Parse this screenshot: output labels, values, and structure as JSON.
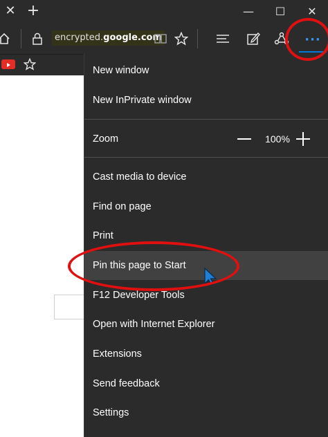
{
  "window": {
    "tab_close_glyph": "✕",
    "new_tab_glyph": "+",
    "minimize_glyph": "—",
    "maximize_glyph": "☐",
    "close_glyph": "✕"
  },
  "address": {
    "prefix": "encrypted.",
    "domain": "google.com"
  },
  "icons": {
    "home": "home-icon",
    "lock": "lock-icon",
    "reading_view": "reading-view-icon",
    "favorite": "star-icon",
    "hub": "hub-icon",
    "web_note": "web-note-icon",
    "share": "share-icon",
    "more": "more-icon",
    "youtube": "youtube-icon",
    "add_favorite": "star-outline-icon"
  },
  "colors": {
    "chrome_bg": "#2b2b2b",
    "menu_bg": "#2b2b2b",
    "highlight_bg": "#414141",
    "accent_blue": "#0078d7",
    "annotation_red": "#e01010"
  },
  "more_button_label": "···",
  "menu": {
    "new_window": "New window",
    "new_inprivate": "New InPrivate window",
    "zoom_label": "Zoom",
    "zoom_value": "100%",
    "zoom_minus": "—",
    "zoom_plus": "+",
    "cast": "Cast media to device",
    "find": "Find on page",
    "print": "Print",
    "pin": "Pin this page to Start",
    "devtools": "F12 Developer Tools",
    "open_ie": "Open with Internet Explorer",
    "extensions": "Extensions",
    "feedback": "Send feedback",
    "settings": "Settings"
  }
}
